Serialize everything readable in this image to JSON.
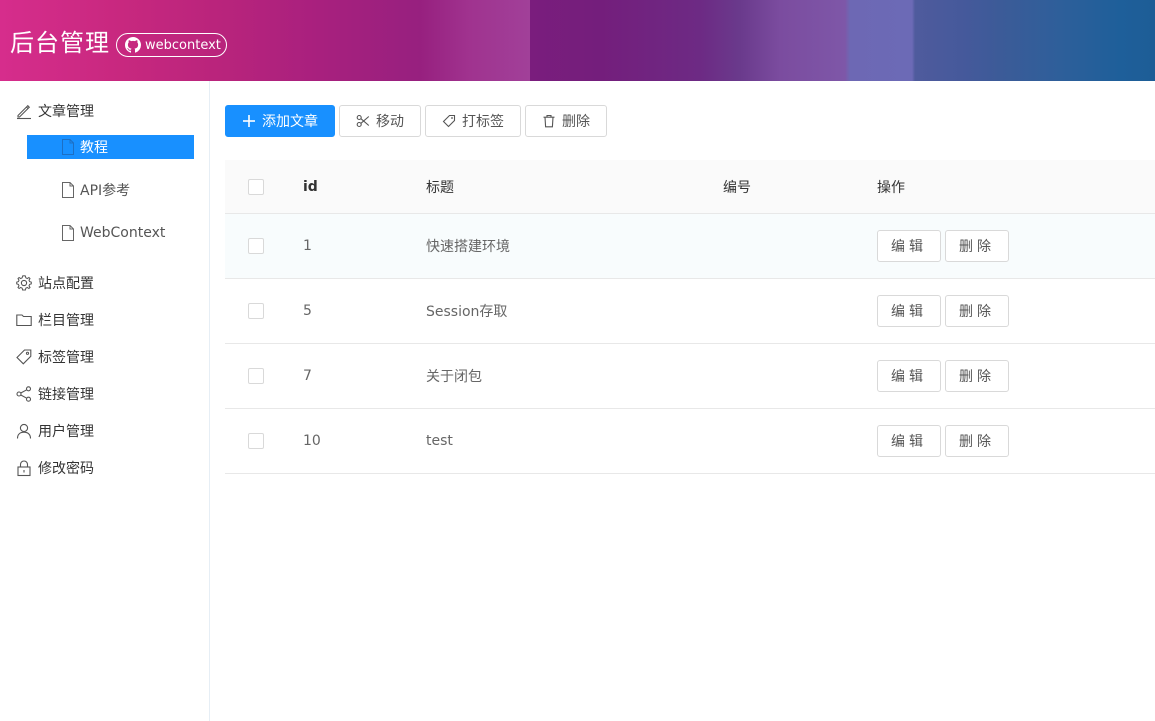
{
  "header": {
    "title": "后台管理",
    "github_badge": "webcontext",
    "github_icon": "github-icon"
  },
  "sidebar": {
    "items": [
      {
        "label": "文章管理",
        "icon": "edit-icon"
      },
      {
        "label": "站点配置",
        "icon": "gear-icon"
      },
      {
        "label": "栏目管理",
        "icon": "folder-icon"
      },
      {
        "label": "标签管理",
        "icon": "tag-icon"
      },
      {
        "label": "链接管理",
        "icon": "share-icon"
      },
      {
        "label": "用户管理",
        "icon": "user-icon"
      },
      {
        "label": "修改密码",
        "icon": "lock-icon"
      }
    ],
    "sub_items": [
      {
        "label": "教程",
        "icon": "file-icon",
        "active": true
      },
      {
        "label": "API参考",
        "icon": "file-icon",
        "active": false
      },
      {
        "label": "WebContext",
        "icon": "file-icon",
        "active": false
      }
    ],
    "active_color": "#1890ff"
  },
  "toolbar": {
    "add_label": "添加文章",
    "move_label": "移动",
    "tag_label": "打标签",
    "delete_label": "删除"
  },
  "table": {
    "columns": [
      "id",
      "标题",
      "编号",
      "操作"
    ],
    "rows": [
      {
        "id": "1",
        "title": "快速搭建环境",
        "code": ""
      },
      {
        "id": "5",
        "title": "Session存取",
        "code": ""
      },
      {
        "id": "7",
        "title": "关于闭包",
        "code": ""
      },
      {
        "id": "10",
        "title": "test",
        "code": ""
      }
    ],
    "edit_label": "编辑",
    "delete_label": "删除"
  }
}
